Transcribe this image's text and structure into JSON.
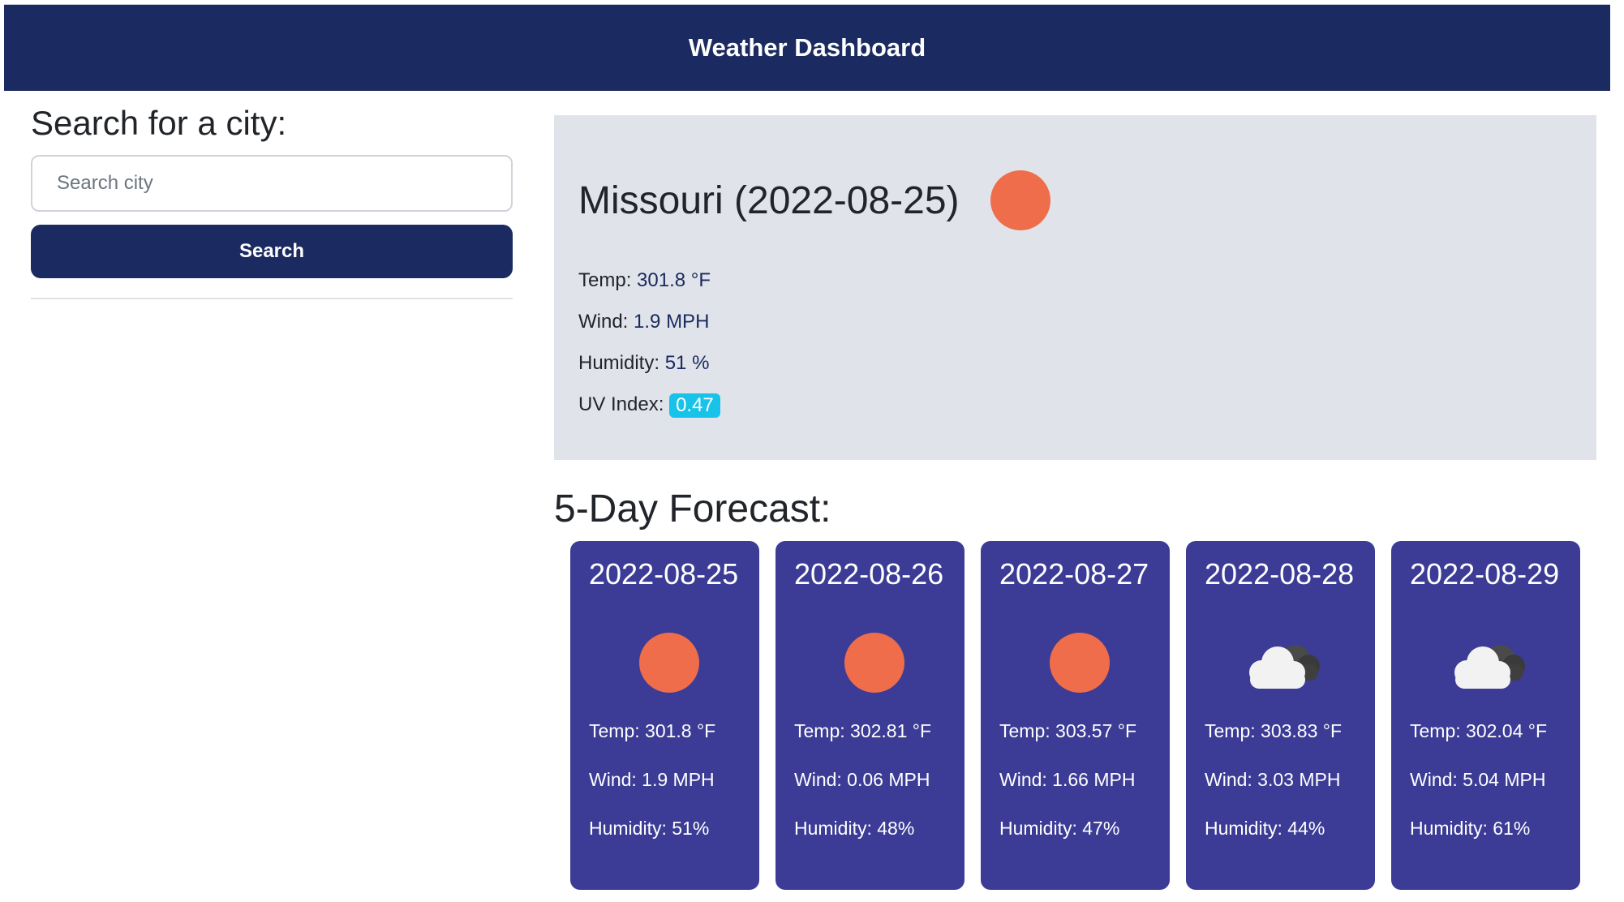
{
  "header": {
    "title": "Weather Dashboard"
  },
  "sidebar": {
    "heading": "Search for a city:",
    "search_placeholder": "Search city",
    "search_button": "Search"
  },
  "current": {
    "title": "Missouri (2022-08-25)",
    "icon": "sun-icon",
    "temp_label": "Temp:",
    "temp_value": "301.8 °F",
    "wind_label": "Wind:",
    "wind_value": "1.9 MPH",
    "humidity_label": "Humidity:",
    "humidity_value": "51 %",
    "uv_label": "UV Index:",
    "uv_value": "0.47"
  },
  "forecast": {
    "heading": "5-Day Forecast:",
    "days": [
      {
        "date": "2022-08-25",
        "icon": "sun-icon",
        "temp": "Temp: 301.8 °F",
        "wind": "Wind: 1.9 MPH",
        "humidity": "Humidity: 51%"
      },
      {
        "date": "2022-08-26",
        "icon": "sun-icon",
        "temp": "Temp: 302.81 °F",
        "wind": "Wind: 0.06 MPH",
        "humidity": "Humidity: 48%"
      },
      {
        "date": "2022-08-27",
        "icon": "sun-icon",
        "temp": "Temp: 303.57 °F",
        "wind": "Wind: 1.66 MPH",
        "humidity": "Humidity: 47%"
      },
      {
        "date": "2022-08-28",
        "icon": "cloud-icon",
        "temp": "Temp: 303.83 °F",
        "wind": "Wind: 3.03 MPH",
        "humidity": "Humidity: 44%"
      },
      {
        "date": "2022-08-29",
        "icon": "cloud-icon",
        "temp": "Temp: 302.04 °F",
        "wind": "Wind: 5.04 MPH",
        "humidity": "Humidity: 61%"
      }
    ]
  },
  "colors": {
    "header_bg": "#1b2a60",
    "card_bg": "#3c3c96",
    "current_bg": "#e0e4ea",
    "sun": "#ef6d4a",
    "uv_badge": "#17c3e8"
  }
}
